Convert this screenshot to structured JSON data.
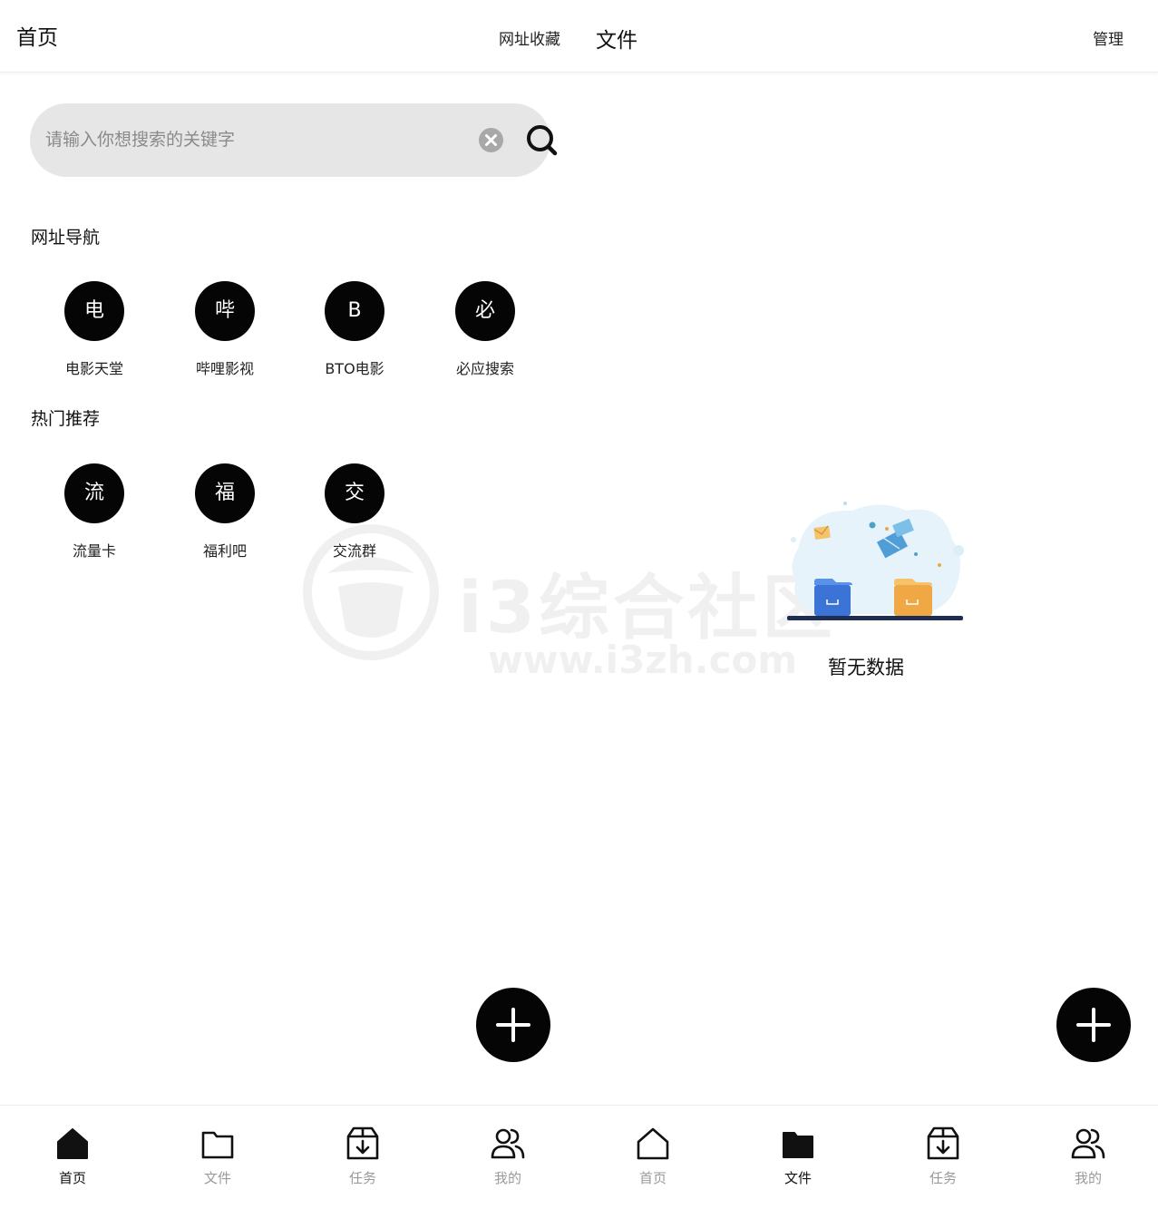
{
  "header": {
    "left_title": "首页",
    "tab_bookmarks": "网址收藏",
    "tab_files": "文件",
    "manage": "管理"
  },
  "search": {
    "placeholder": "请输入你想搜索的关键字"
  },
  "nav_section": {
    "title": "网址导航",
    "items": [
      {
        "initial": "电",
        "label": "电影天堂"
      },
      {
        "initial": "哔",
        "label": "哔哩影视"
      },
      {
        "initial": "B",
        "label": "BTO电影"
      },
      {
        "initial": "必",
        "label": "必应搜索"
      }
    ]
  },
  "hot_section": {
    "title": "热门推荐",
    "items": [
      {
        "initial": "流",
        "label": "流量卡"
      },
      {
        "initial": "福",
        "label": "福利吧"
      },
      {
        "initial": "交",
        "label": "交流群"
      }
    ]
  },
  "files_panel": {
    "empty_text": "暂无数据"
  },
  "watermark": {
    "name": "i3综合社区",
    "url": "www.i3zh.com"
  },
  "bottom_nav": {
    "items": [
      {
        "label": "首页",
        "icon": "home-filled-icon",
        "active": true
      },
      {
        "label": "文件",
        "icon": "folder-outline-icon",
        "active": false
      },
      {
        "label": "任务",
        "icon": "download-box-icon",
        "active": false
      },
      {
        "label": "我的",
        "icon": "users-icon",
        "active": false
      },
      {
        "label": "首页",
        "icon": "home-outline-icon",
        "active": false
      },
      {
        "label": "文件",
        "icon": "folder-filled-icon",
        "active": true
      },
      {
        "label": "任务",
        "icon": "download-box-icon",
        "active": false
      },
      {
        "label": "我的",
        "icon": "users-icon",
        "active": false
      }
    ]
  },
  "colors": {
    "accent": "#050505",
    "search_bg": "#e6e6e6",
    "inactive": "#9a9a9a"
  }
}
